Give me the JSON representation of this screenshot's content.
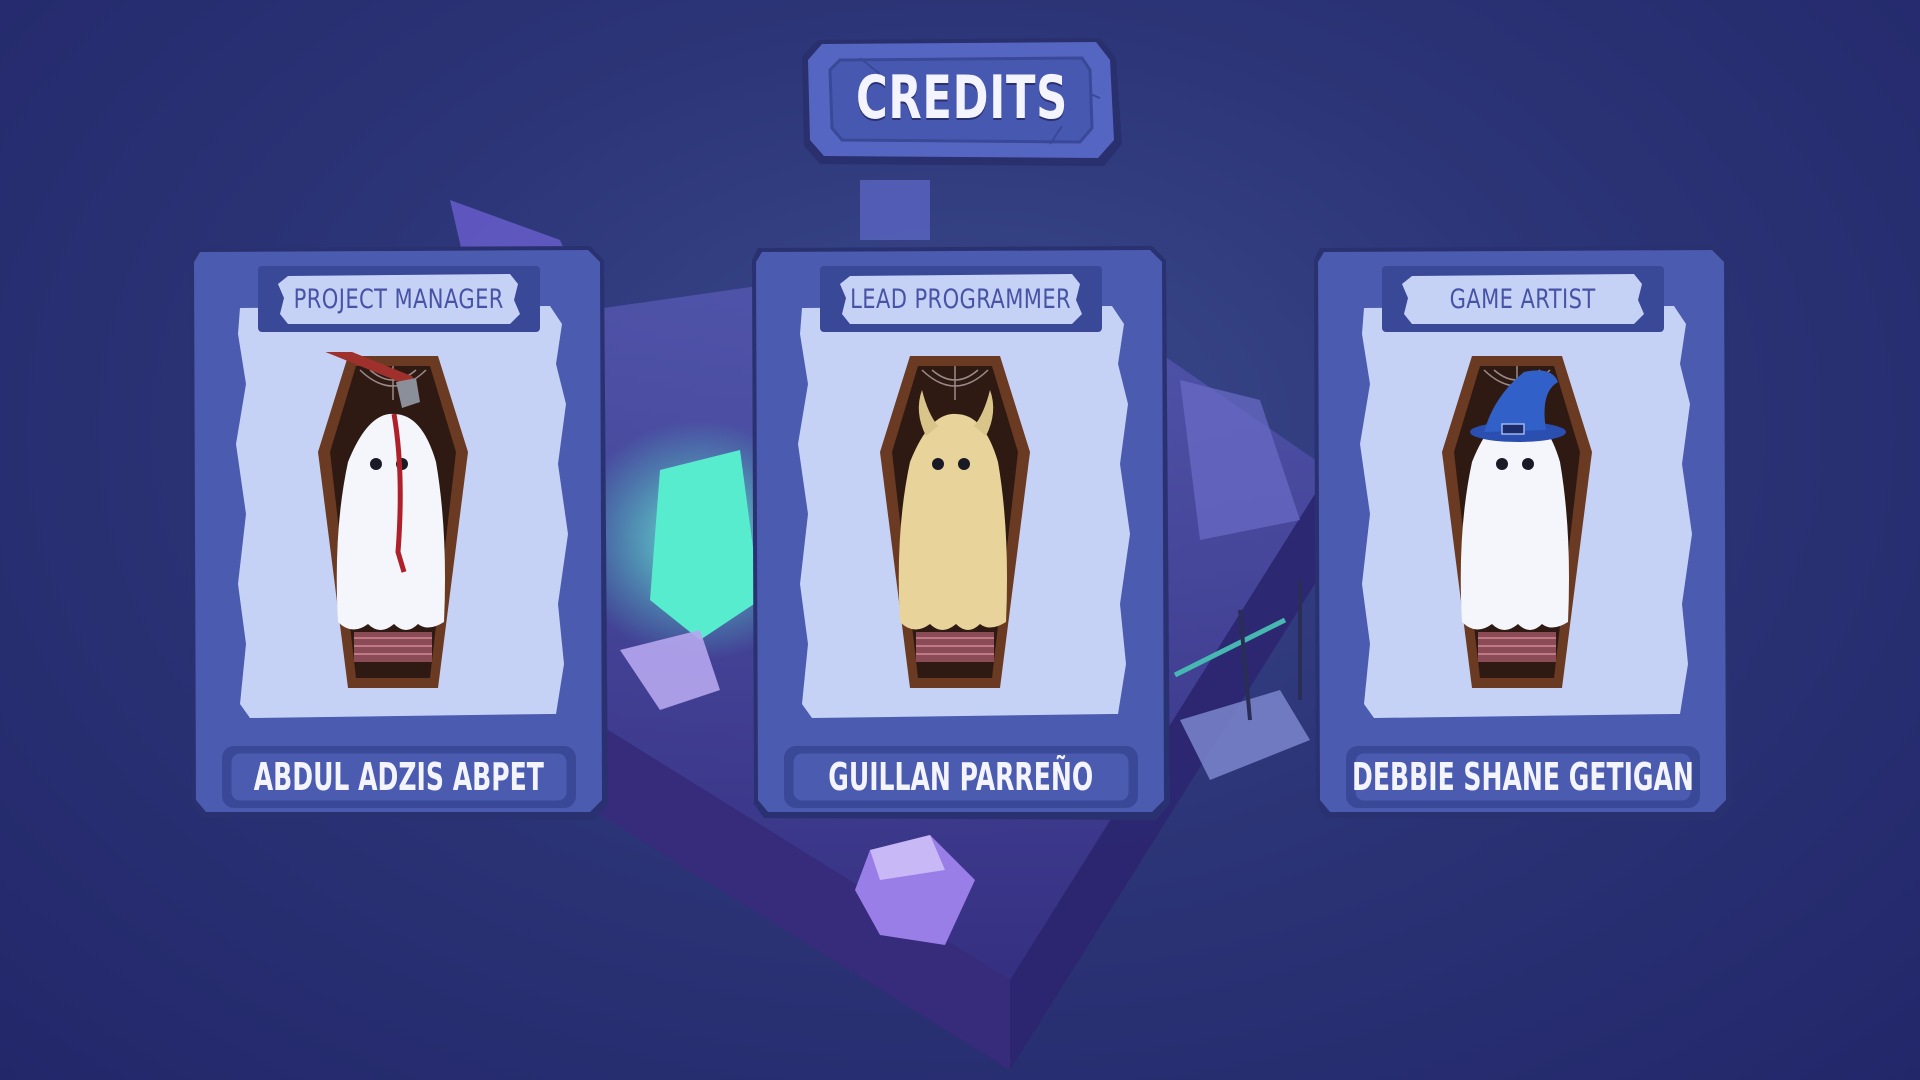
{
  "screen": {
    "title": "CREDITS"
  },
  "credits": [
    {
      "role": "PROJECT MANAGER",
      "name": "ABDUL ADZIS ABPET",
      "portrait_icon": "ghost-with-axe-icon",
      "ghost_color": "#f4f6fb"
    },
    {
      "role": "LEAD PROGRAMMER",
      "name": "GUILLAN PARREÑO",
      "portrait_icon": "horned-ghost-icon",
      "ghost_color": "#e8d49a"
    },
    {
      "role": "GAME ARTIST",
      "name": "DEBBIE SHANE GETIGAN",
      "portrait_icon": "wizard-hat-ghost-icon",
      "ghost_color": "#f4f6fb"
    }
  ],
  "colors": {
    "background": "#2c3577",
    "card_frame": "#4a5bb0",
    "card_panel": "#c6d2f5",
    "label_text": "#4753a6",
    "title_text": "#f4f4ff",
    "crystal_glow": "#4fe0c8"
  }
}
